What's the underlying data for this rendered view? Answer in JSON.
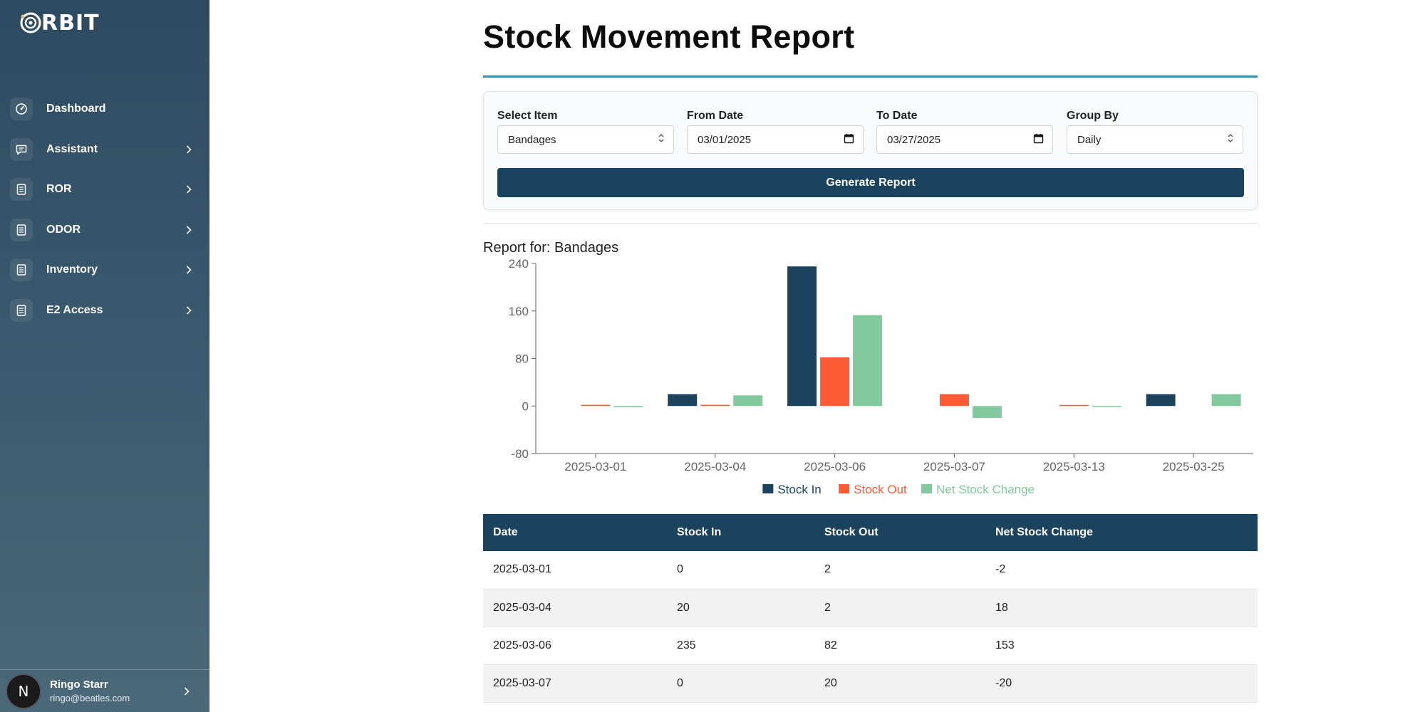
{
  "app": {
    "logo_text": "RBIT"
  },
  "sidebar": {
    "items": [
      {
        "label": "Dashboard",
        "icon": "gauge-icon",
        "has_submenu": false
      },
      {
        "label": "Assistant",
        "icon": "chat-icon",
        "has_submenu": true
      },
      {
        "label": "ROR",
        "icon": "document-icon",
        "has_submenu": true
      },
      {
        "label": "ODOR",
        "icon": "document-icon",
        "has_submenu": true
      },
      {
        "label": "Inventory",
        "icon": "document-icon",
        "has_submenu": true
      },
      {
        "label": "E2 Access",
        "icon": "document-icon",
        "has_submenu": true
      }
    ]
  },
  "user": {
    "initial": "N",
    "name": "Ringo Starr",
    "email": "ringo@beatles.com"
  },
  "page": {
    "title": "Stock Movement Report"
  },
  "filters": {
    "select_item": {
      "label": "Select Item",
      "value": "Bandages"
    },
    "from_date": {
      "label": "From Date",
      "value": "03/01/2025"
    },
    "to_date": {
      "label": "To Date",
      "value": "03/27/2025"
    },
    "group_by": {
      "label": "Group By",
      "value": "Daily"
    },
    "generate_label": "Generate Report"
  },
  "report": {
    "heading": "Report for: Bandages"
  },
  "colors": {
    "stock_in": "#1b435e",
    "stock_out": "#ff5a36",
    "net": "#82ca9d",
    "accent": "#3a8ca8"
  },
  "chart_data": {
    "type": "bar",
    "categories": [
      "2025-03-01",
      "2025-03-04",
      "2025-03-06",
      "2025-03-07",
      "2025-03-13",
      "2025-03-25"
    ],
    "series": [
      {
        "name": "Stock In",
        "values": [
          0,
          20,
          235,
          0,
          0,
          20
        ]
      },
      {
        "name": "Stock Out",
        "values": [
          2,
          2,
          82,
          20,
          1,
          0
        ]
      },
      {
        "name": "Net Stock Change",
        "values": [
          -2,
          18,
          153,
          -20,
          -1,
          20
        ]
      }
    ],
    "yticks": [
      -80,
      0,
      80,
      160,
      240
    ],
    "ylim": [
      -80,
      240
    ],
    "legend_position": "bottom"
  },
  "table": {
    "headers": [
      "Date",
      "Stock In",
      "Stock Out",
      "Net Stock Change"
    ],
    "rows": [
      [
        "2025-03-01",
        "0",
        "2",
        "-2"
      ],
      [
        "2025-03-04",
        "20",
        "2",
        "18"
      ],
      [
        "2025-03-06",
        "235",
        "82",
        "153"
      ],
      [
        "2025-03-07",
        "0",
        "20",
        "-20"
      ]
    ]
  }
}
